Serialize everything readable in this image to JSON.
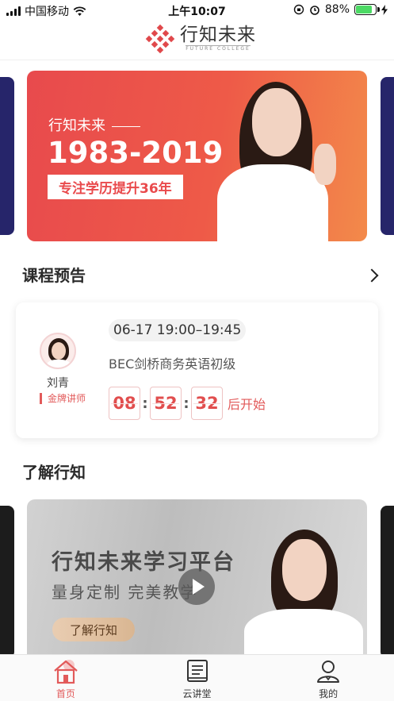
{
  "status_bar": {
    "carrier": "中国移动",
    "time": "上午10:07",
    "battery_percent": "88%",
    "battery_level": 0.88
  },
  "header": {
    "logo_cn": "行知未来",
    "logo_en": "FUTURE COLLEGE"
  },
  "banner": {
    "subtitle": "行知未来",
    "years": "1983-2019",
    "tagline": "专注学历提升36年"
  },
  "course_section": {
    "title": "课程预告",
    "card": {
      "teacher_name": "刘青",
      "teacher_role": "金牌讲师",
      "time": "06-17 19:00–19:45",
      "course_name": "BEC剑桥商务英语初级",
      "countdown": [
        "08",
        "52",
        "32"
      ],
      "countdown_suffix": "后开始"
    }
  },
  "about_section": {
    "title": "了解行知",
    "banner_title": "行知未来学习平台",
    "banner_subtitle": "量身定制 完美教学",
    "button_label": "了解行知"
  },
  "tabbar": {
    "items": [
      {
        "label": "首页",
        "icon": "home-icon"
      },
      {
        "label": "云讲堂",
        "icon": "book-icon"
      },
      {
        "label": "我的",
        "icon": "user-icon"
      }
    ]
  },
  "colors": {
    "accent": "#e25a5a",
    "banner_red": "#e84a4d",
    "banner_orange": "#f38a4a"
  }
}
